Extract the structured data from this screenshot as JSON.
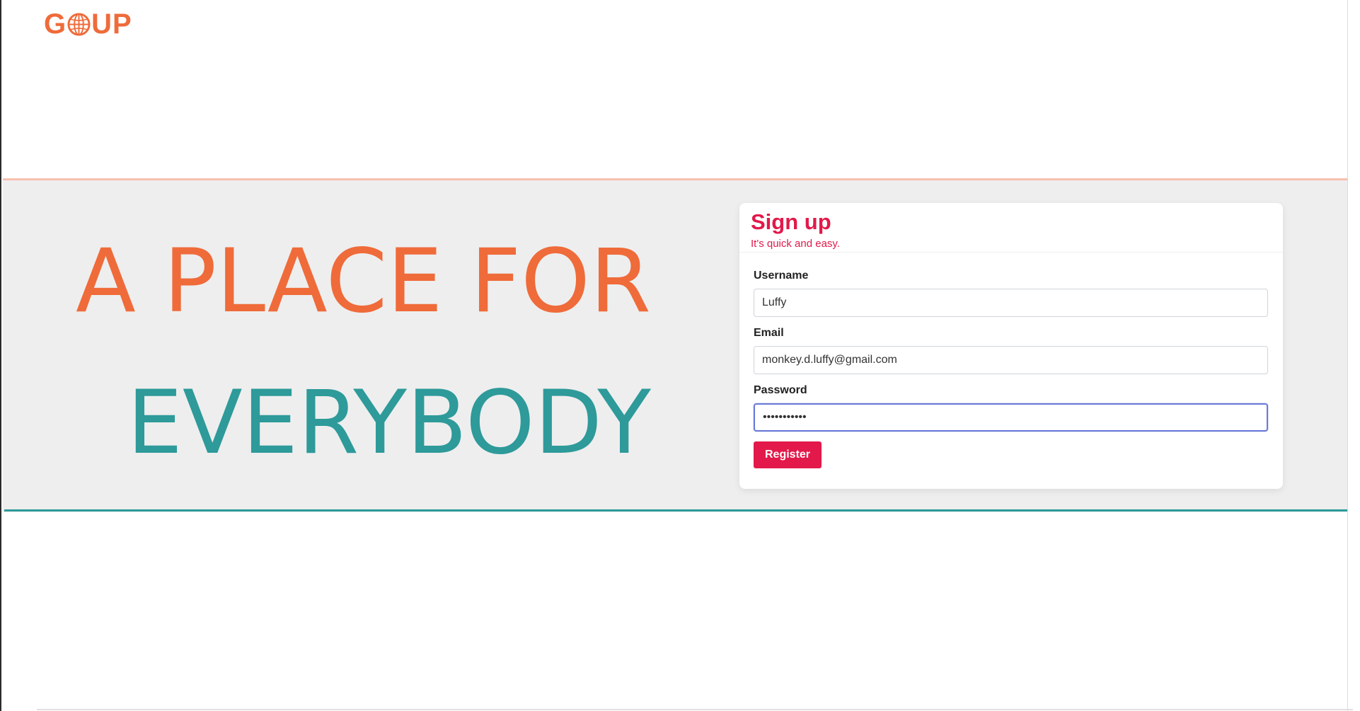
{
  "brand": {
    "logo_left": "G",
    "logo_right": "UP",
    "color": "#ef6b3a"
  },
  "hero": {
    "line1": "A PLACE FOR",
    "line2": "EVERYBODY",
    "line1_color": "#ef6b3a",
    "line2_color": "#2e9a9a"
  },
  "signup": {
    "title": "Sign up",
    "subtitle": "It's quick and easy.",
    "username": {
      "label": "Username",
      "value": "Luffy"
    },
    "email": {
      "label": "Email",
      "value": "monkey.d.luffy@gmail.com"
    },
    "password": {
      "label": "Password",
      "value": "•••••••••••"
    },
    "register_label": "Register",
    "accent_color": "#e2194a"
  },
  "icons": {
    "logo_globe": "globe-icon"
  }
}
